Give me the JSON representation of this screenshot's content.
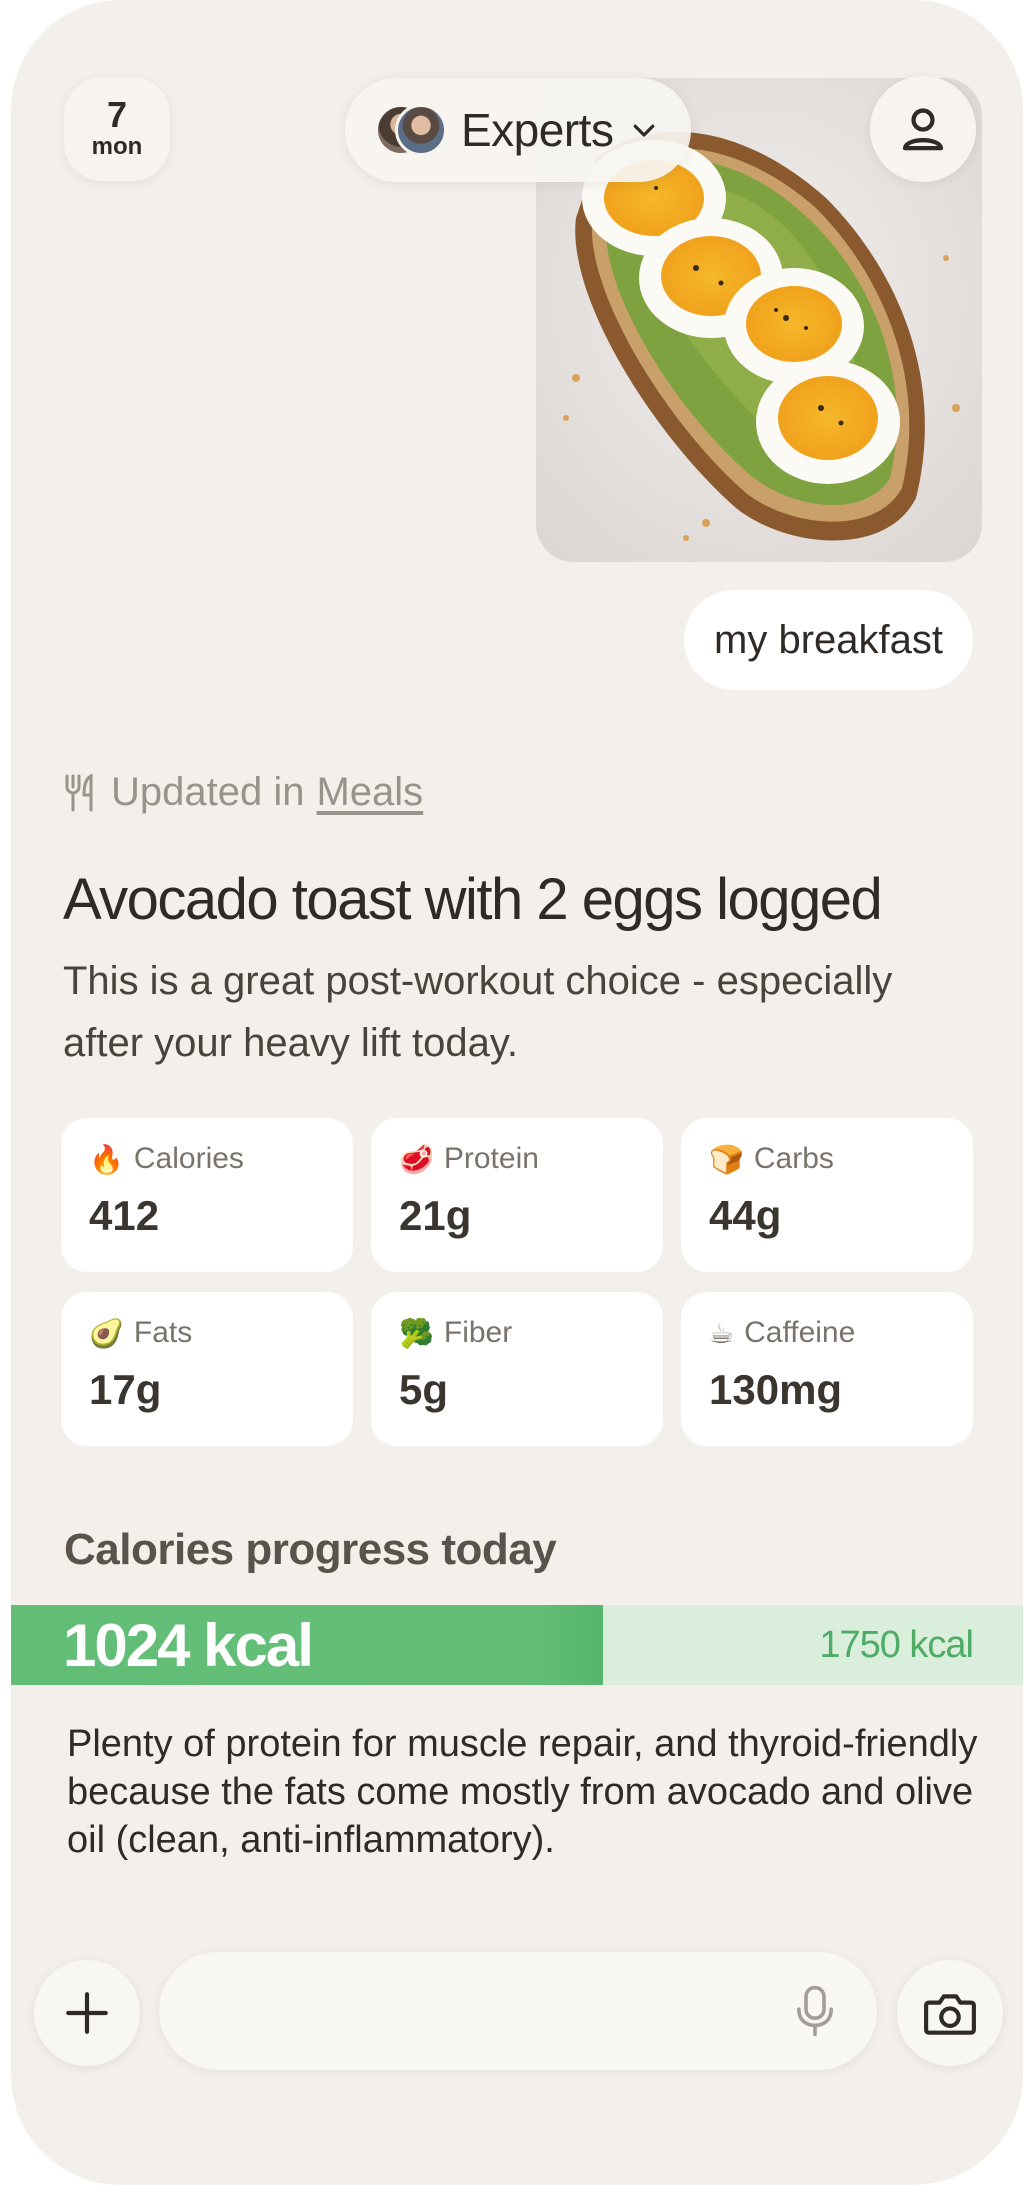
{
  "header": {
    "date_number": "7",
    "date_day": "mon",
    "experts_label": "Experts"
  },
  "message": {
    "text": "my breakfast"
  },
  "update": {
    "prefix": "Updated in",
    "link": "Meals"
  },
  "meal": {
    "title": "Avocado toast with 2 eggs logged",
    "subtitle": "This is a great post-workout choice - especially after your heavy lift today."
  },
  "nutrients": [
    {
      "icon": "fire-icon",
      "emoji": "🔥",
      "label": "Calories",
      "value": "412"
    },
    {
      "icon": "meat-icon",
      "emoji": "🥩",
      "label": "Protein",
      "value": "21g"
    },
    {
      "icon": "bread-icon",
      "emoji": "🍞",
      "label": "Carbs",
      "value": "44g"
    },
    {
      "icon": "avocado-icon",
      "emoji": "🥑",
      "label": "Fats",
      "value": "17g"
    },
    {
      "icon": "broccoli-icon",
      "emoji": "🥦",
      "label": "Fiber",
      "value": "5g"
    },
    {
      "icon": "coffee-icon",
      "emoji": "☕",
      "label": "Caffeine",
      "value": "130mg"
    }
  ],
  "progress": {
    "title": "Calories progress today",
    "consumed_label": "1024 kcal",
    "goal_label": "1750 kcal",
    "consumed": 1024,
    "goal": 1750,
    "fill_color": "#62bd76",
    "track_color": "#d9eedb"
  },
  "note": "Plenty of protein for muscle repair, and thyroid-friendly because the fats come mostly from avocado and olive oil (clean, anti-inflammatory).",
  "composer": {
    "placeholder": ""
  },
  "colors": {
    "background": "#f3efea",
    "accent_green": "#62bd76",
    "text_dark": "#2f2a26",
    "text_muted": "#9a938b"
  }
}
